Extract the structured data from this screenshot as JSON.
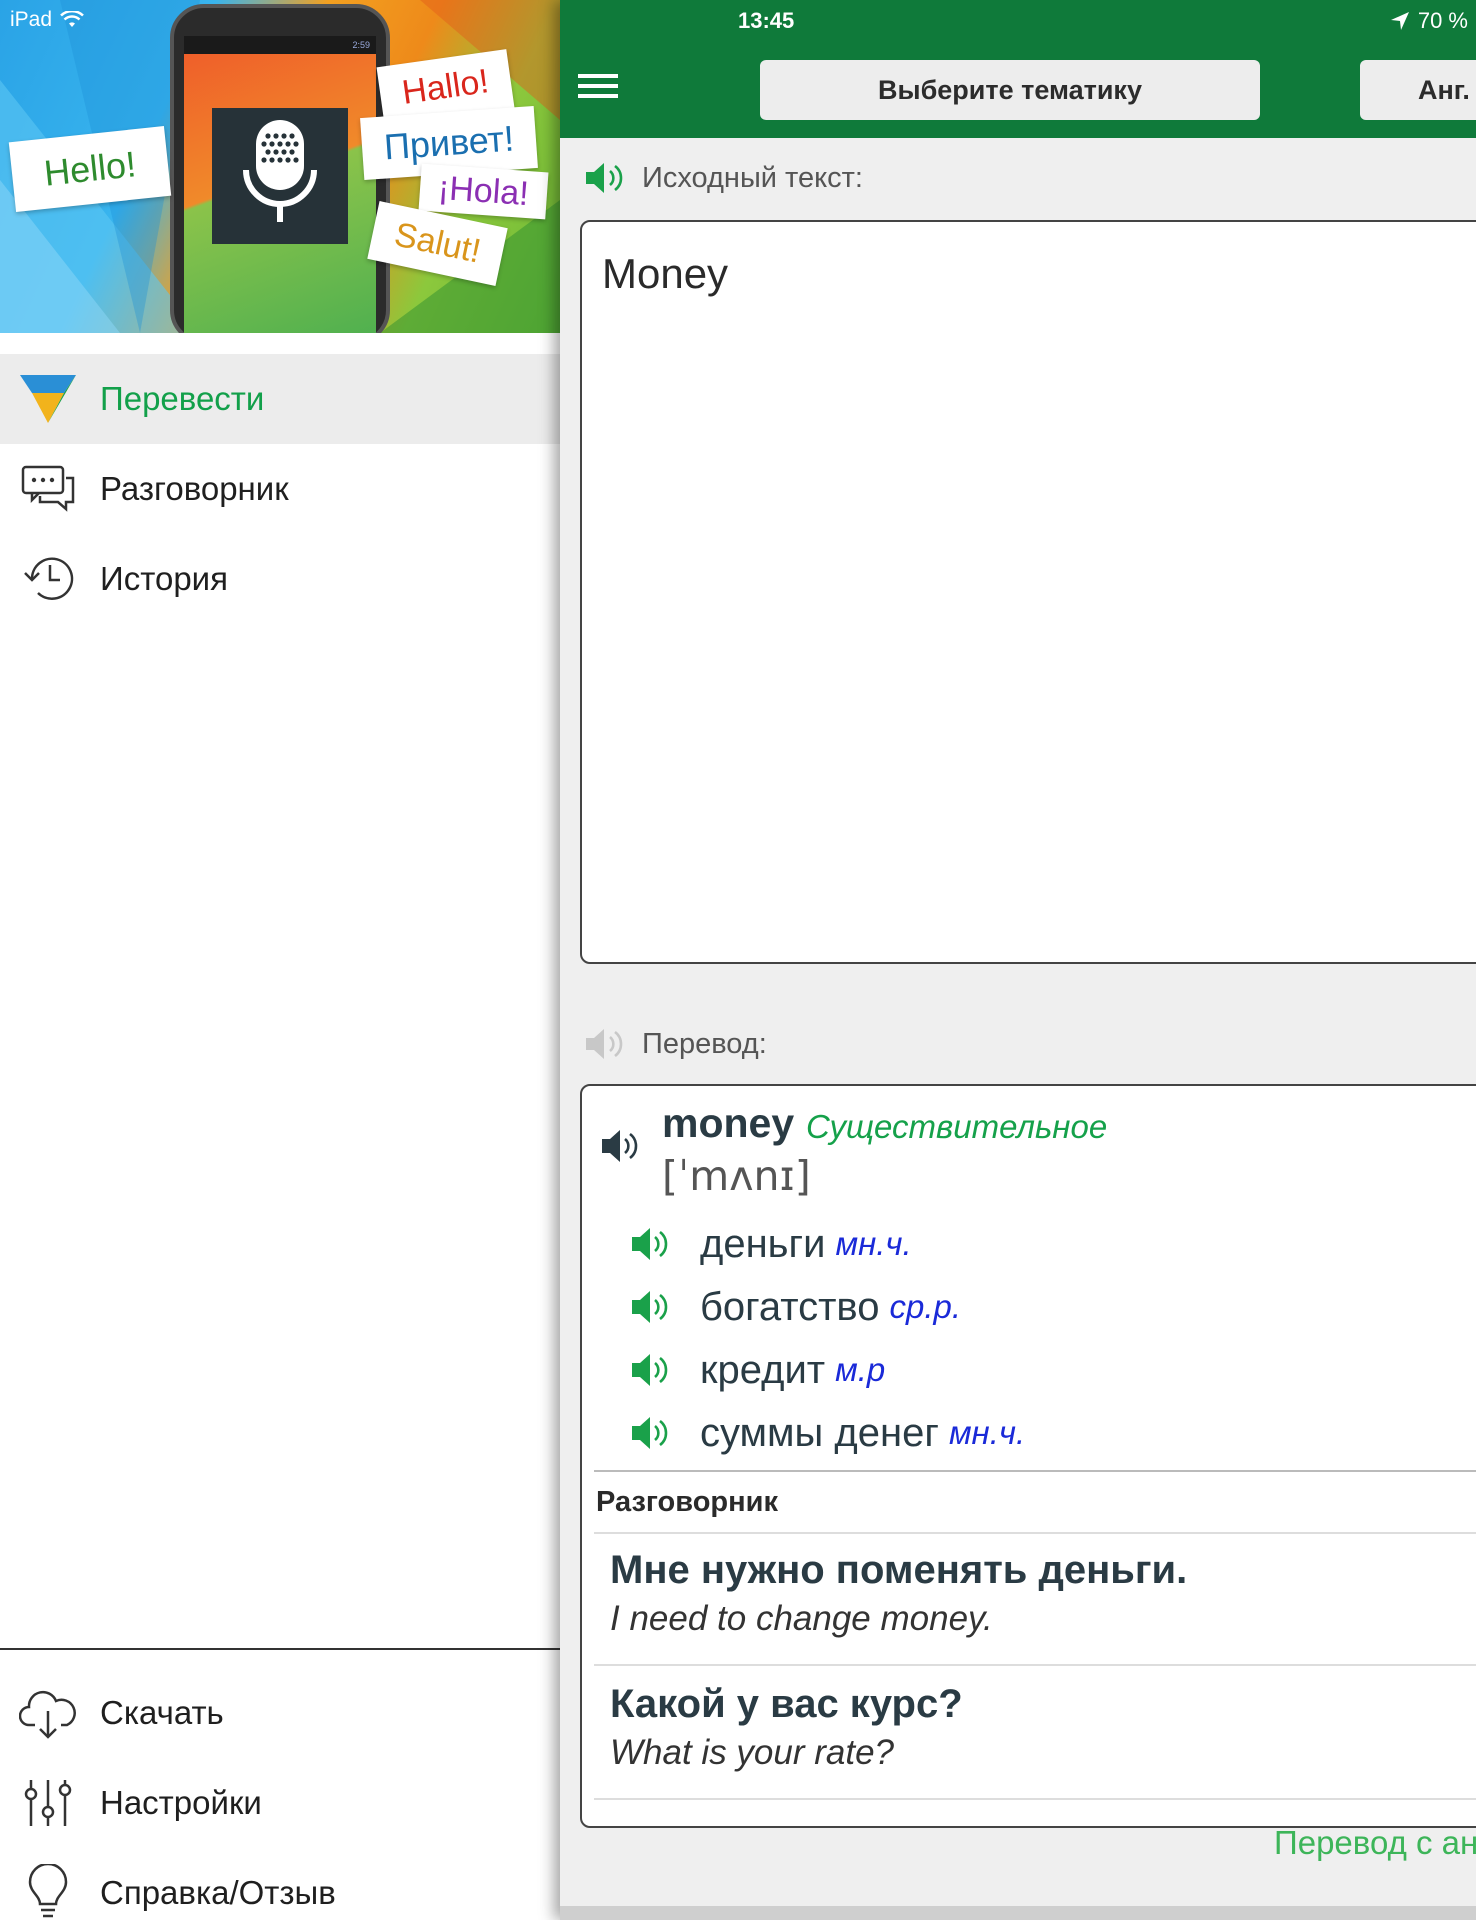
{
  "status_bar": {
    "device": "iPad",
    "time": "13:45",
    "battery": "70 %"
  },
  "banner": {
    "greetings": [
      "Hallo!",
      "Привет!",
      "¡Hola!",
      "Salut!",
      "Hello!"
    ],
    "phone_clock": "2:59"
  },
  "drawer": {
    "nav": [
      {
        "label": "Перевести",
        "icon": "translate-logo-icon",
        "active": true
      },
      {
        "label": "Разговорник",
        "icon": "chat-bubbles-icon",
        "active": false
      },
      {
        "label": "История",
        "icon": "history-clock-icon",
        "active": false
      }
    ],
    "bottom_nav": [
      {
        "label": "Скачать",
        "icon": "cloud-download-icon"
      },
      {
        "label": "Настройки",
        "icon": "sliders-icon"
      },
      {
        "label": "Справка/Отзыв",
        "icon": "lightbulb-icon"
      }
    ]
  },
  "toolbar": {
    "topic_button": "Выберите тематику",
    "lang_button": "Анг."
  },
  "source": {
    "label": "Исходный текст:",
    "text": "Money"
  },
  "translation": {
    "label": "Перевод:",
    "headword": "money",
    "part_of_speech": "Существительное",
    "ipa": "[ˈmʌnɪ]",
    "variants": [
      {
        "word": "деньги",
        "gram": "мн.ч."
      },
      {
        "word": "богатство",
        "gram": "ср.р."
      },
      {
        "word": "кредит",
        "gram": "м.р"
      },
      {
        "word": "суммы денег",
        "gram": "мн.ч."
      }
    ],
    "phrasebook_heading": "Разговорник",
    "phrases": [
      {
        "ru": "Мне нужно поменять деньги.",
        "en": "I need to change money."
      },
      {
        "ru": "Какой у вас курс?",
        "en": "What is your rate?"
      }
    ]
  },
  "footer_note": "Перевод с ан",
  "colors": {
    "brand_green": "#0f7a3a",
    "accent_green": "#12a04a",
    "grammar_blue": "#1a2ad8"
  }
}
